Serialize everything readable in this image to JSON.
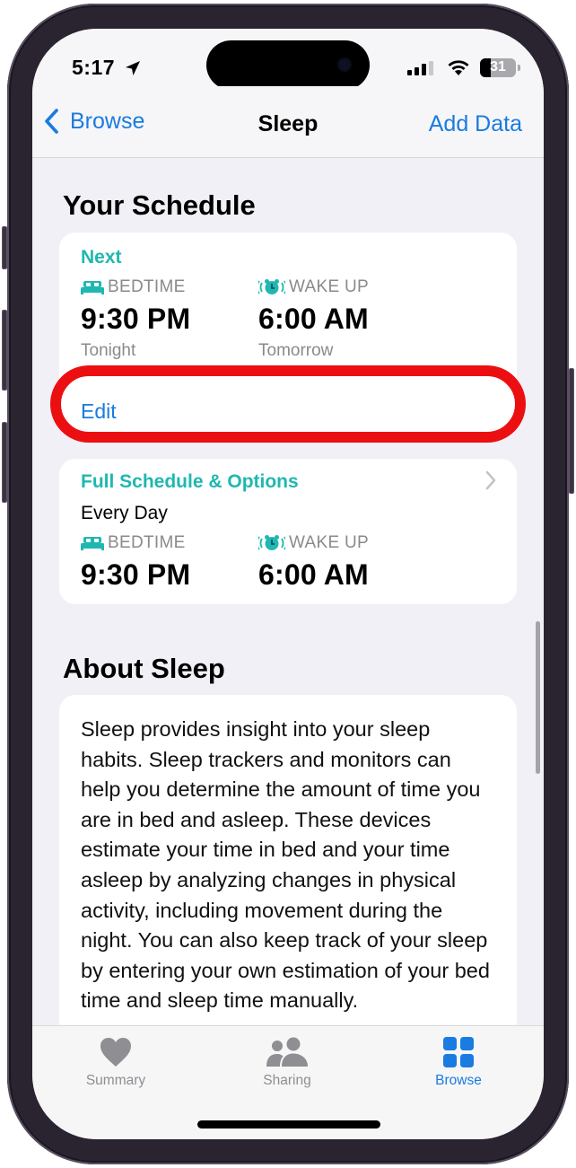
{
  "status_bar": {
    "time": "5:17",
    "location_icon": "location-arrow-icon",
    "signal_icon": "cellular-signal-icon",
    "wifi_icon": "wifi-icon",
    "battery_level": "31",
    "battery_percent": 31
  },
  "nav": {
    "back_label": "Browse",
    "title": "Sleep",
    "action_label": "Add Data"
  },
  "schedule": {
    "section_title": "Your Schedule",
    "next_card": {
      "heading": "Next",
      "bedtime": {
        "label": "BEDTIME",
        "time": "9:30 PM",
        "sub": "Tonight",
        "icon": "bed-icon"
      },
      "wakeup": {
        "label": "WAKE UP",
        "time": "6:00 AM",
        "sub": "Tomorrow",
        "icon": "alarm-clock-icon"
      },
      "edit_label": "Edit"
    },
    "full_card": {
      "heading": "Full Schedule & Options",
      "days": "Every Day",
      "bedtime": {
        "label": "BEDTIME",
        "time": "9:30 PM",
        "icon": "bed-icon"
      },
      "wakeup": {
        "label": "WAKE UP",
        "time": "6:00 AM",
        "icon": "alarm-clock-icon"
      }
    }
  },
  "about": {
    "section_title": "About Sleep",
    "body": "Sleep provides insight into your sleep habits. Sleep trackers and monitors can help you determine the amount of time you are in bed and asleep. These devices estimate your time in bed and your time asleep by analyzing changes in physical activity, including movement during the night. You can also keep track of your sleep by entering your own estimation of your bed time and sleep time manually."
  },
  "tab_bar": {
    "items": [
      {
        "label": "Summary",
        "icon": "heart-icon",
        "active": false
      },
      {
        "label": "Sharing",
        "icon": "people-icon",
        "active": false
      },
      {
        "label": "Browse",
        "icon": "grid-icon",
        "active": true
      }
    ]
  },
  "colors": {
    "accent_blue": "#1a7be0",
    "sleep_teal": "#1fb8b0",
    "highlight_red": "#ec0f12",
    "secondary_gray": "#8a8a8e"
  }
}
